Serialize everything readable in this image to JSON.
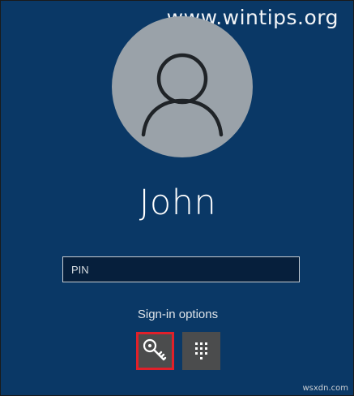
{
  "watermark": {
    "text": "www.wintips.org"
  },
  "user": {
    "name": "John",
    "avatar_icon": "person-icon"
  },
  "pin_field": {
    "placeholder": "PIN",
    "value": ""
  },
  "sign_in_options": {
    "label": "Sign-in options",
    "options": [
      {
        "icon": "key-icon",
        "selected": true
      },
      {
        "icon": "keypad-icon",
        "selected": false
      }
    ]
  },
  "corner_watermark": {
    "text": "wsxdn.com"
  },
  "colors": {
    "background": "#0a3866",
    "avatar": "#9aa2a9",
    "option_button": "#4b4c4d",
    "highlight": "#e0202a"
  }
}
